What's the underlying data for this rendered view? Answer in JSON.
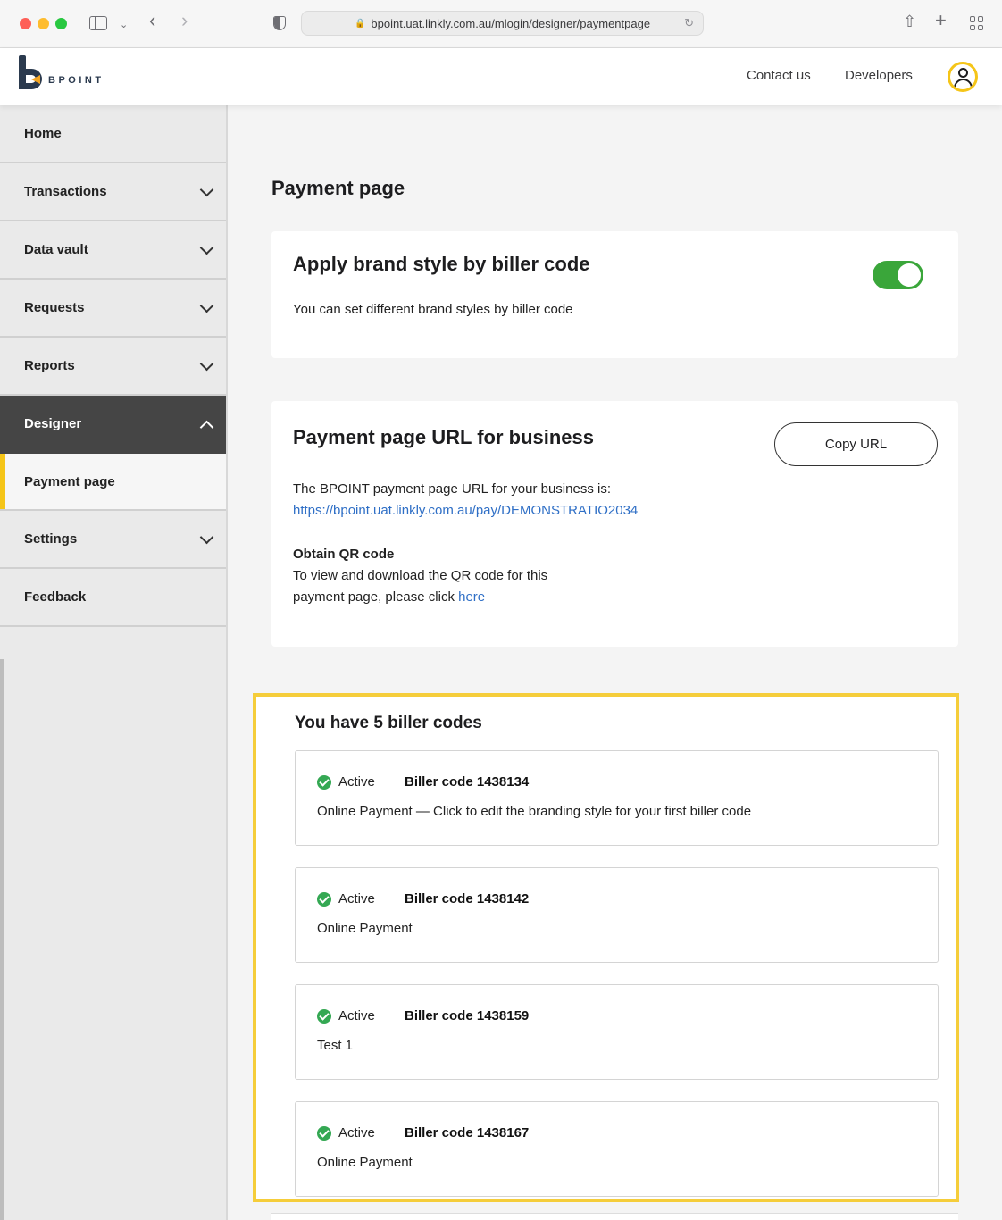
{
  "browser": {
    "url": "bpoint.uat.linkly.com.au/mlogin/designer/paymentpage"
  },
  "header": {
    "logo_text": "BPOINT",
    "contact_label": "Contact us",
    "developers_label": "Developers"
  },
  "sidebar": {
    "items": [
      {
        "label": "Home"
      },
      {
        "label": "Transactions"
      },
      {
        "label": "Data vault"
      },
      {
        "label": "Requests"
      },
      {
        "label": "Reports"
      },
      {
        "label": "Designer"
      },
      {
        "label": "Payment page"
      },
      {
        "label": "Settings"
      },
      {
        "label": "Feedback"
      }
    ]
  },
  "main": {
    "page_title": "Payment page",
    "brand_card": {
      "title": "Apply brand style by biller code",
      "description": "You can set different brand styles by biller code",
      "toggle_on": true
    },
    "url_card": {
      "title": "Payment page URL for business",
      "copy_label": "Copy URL",
      "intro": "The BPOINT payment page URL for your business is:",
      "url": "https://bpoint.uat.linkly.com.au/pay/DEMONSTRATIO2034",
      "qr_heading": "Obtain QR code",
      "qr_text_1": "To view and download the QR code for this",
      "qr_text_2": "payment page, please click ",
      "qr_link": "here"
    },
    "billers": {
      "heading": "You have 5 biller codes",
      "items": [
        {
          "status": "Active",
          "code": "Biller code 1438134",
          "desc": "Online Payment — Click to edit the branding style for your first biller code"
        },
        {
          "status": "Active",
          "code": "Biller code 1438142",
          "desc": "Online Payment"
        },
        {
          "status": "Active",
          "code": "Biller code 1438159",
          "desc": "Test 1"
        },
        {
          "status": "Active",
          "code": "Biller code 1438167",
          "desc": "Online Payment"
        }
      ]
    }
  },
  "colors": {
    "accent_yellow": "#f5c518",
    "toggle_green": "#3aa63a",
    "active_green": "#34a853",
    "link_blue": "#2f6fc6",
    "nav_active_bg": "#454545"
  }
}
